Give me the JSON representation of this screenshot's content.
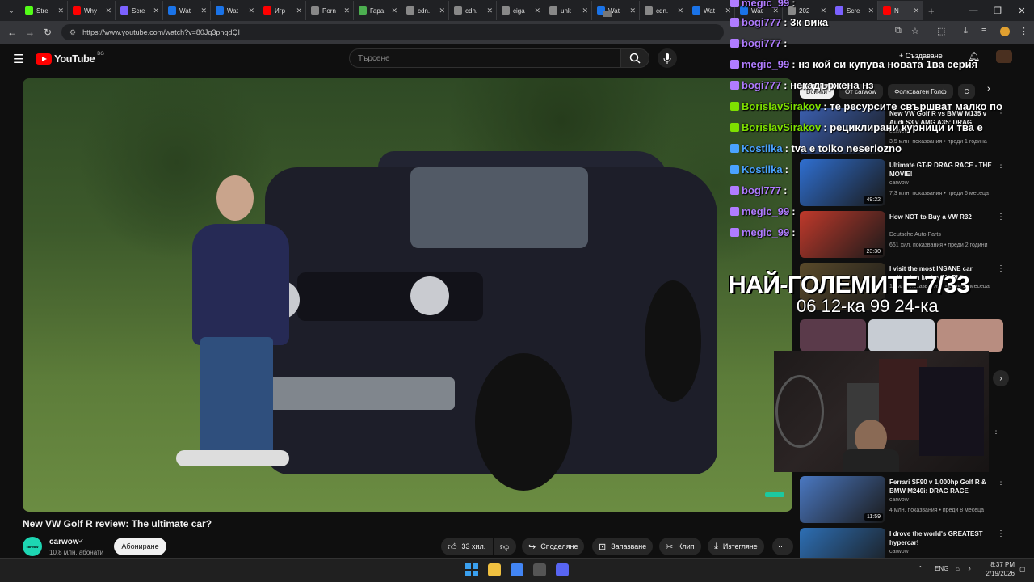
{
  "browser": {
    "tabs": [
      {
        "label": "Stre",
        "color": "#53fc18"
      },
      {
        "label": "Why",
        "color": "#ff0000"
      },
      {
        "label": "Scre",
        "color": "#7b61ff"
      },
      {
        "label": "Wat",
        "color": "#1a73e8"
      },
      {
        "label": "Wat",
        "color": "#1a73e8"
      },
      {
        "label": "Игр",
        "color": "#ff0000"
      },
      {
        "label": "Porn",
        "color": "#888888"
      },
      {
        "label": "Гара",
        "color": "#4caf50"
      },
      {
        "label": "cdn.",
        "color": "#888888"
      },
      {
        "label": "cdn.",
        "color": "#888888"
      },
      {
        "label": "ciga",
        "color": "#888888"
      },
      {
        "label": "unk",
        "color": "#888888"
      },
      {
        "label": "Wat",
        "color": "#1a73e8"
      },
      {
        "label": "cdn.",
        "color": "#888888"
      },
      {
        "label": "Wat",
        "color": "#1a73e8"
      },
      {
        "label": "Wat",
        "color": "#1a73e8"
      },
      {
        "label": "202",
        "color": "#888888"
      },
      {
        "label": "Scre",
        "color": "#7b61ff"
      },
      {
        "label": "N",
        "color": "#ff0000"
      }
    ],
    "url": "https://www.youtube.com/watch?v=80Jq3pnqdQI",
    "new_tab": "+",
    "window": {
      "minimize": "—",
      "restore": "❐",
      "close": "✕"
    }
  },
  "youtube": {
    "logo_text": "YouTube",
    "region": "BG",
    "search_placeholder": "Търсене",
    "create_label": "+ Създаване"
  },
  "video": {
    "title": "New VW Golf R review: The ultimate car?",
    "channel": "carwow",
    "subscribers": "10,8 млн. абонати",
    "subscribe_label": "Абониране",
    "likes": "33 хил.",
    "share_label": "Споделяне",
    "save_label": "Запазване",
    "clip_label": "Клип",
    "download_label": "Изтегляне",
    "more_label": "⋯"
  },
  "chips": [
    "Всички",
    "От carwow",
    "Фолксваген Голф",
    "С"
  ],
  "recommendations": [
    {
      "title": "New VW Golf R vs BMW M135 v Audi S3 v AMG A35: DRAG",
      "channel": "carwow",
      "meta": "3,5 млн. показвания • преди 1 година",
      "duration": "",
      "thumb": "#3b5fb0"
    },
    {
      "title": "Ultimate GT-R DRAG RACE - THE MOVIE!",
      "channel": "carwow",
      "meta": "7,3 млн. показвания • преди 6 месеца",
      "duration": "49:22",
      "thumb": "#2f6fd1"
    },
    {
      "title": "How NOT to Buy a VW R32",
      "channel": "Deutsche Auto Parts",
      "meta": "661 хил. показвания • преди 2 години",
      "duration": "23:30",
      "thumb": "#c0392b"
    },
    {
      "title": "I visit the most INSANE car collection in the WORLD",
      "channel": "",
      "meta": "11 млн. показвания • преди 11 месеца",
      "duration": "",
      "thumb": "#5a4a2a"
    },
    {
      "title": "Ferrari SF90 v 1,000hp Golf R & BMW M240i: DRAG RACE",
      "channel": "carwow",
      "meta": "4 млн. показвания • преди 8 месеца",
      "duration": "11:59",
      "thumb": "#4a78c2"
    },
    {
      "title": "I drove the world's GREATEST hypercar!",
      "channel": "carwow",
      "meta": "",
      "duration": "",
      "thumb": "#2d6fb5"
    }
  ],
  "overlay": {
    "chat": [
      {
        "user": "megic_99",
        "msg": ":",
        "color": "#b07cff"
      },
      {
        "user": "bogi777",
        "msg": ": 3к вика",
        "color": "#b07cff"
      },
      {
        "user": "bogi777",
        "msg": ":",
        "color": "#b07cff"
      },
      {
        "user": "megic_99",
        "msg": ": нз кой си купува новата 1ва серия",
        "color": "#b07cff"
      },
      {
        "user": "bogi777",
        "msg": ": некадържена нз",
        "color": "#b07cff"
      },
      {
        "user": "BorislavSirakov",
        "msg": ": те ресурсите свършват малко по",
        "color": "#7ee000"
      },
      {
        "user": "BorislavSirakov",
        "msg": ": рециклирани курници и тва е",
        "color": "#7ee000"
      },
      {
        "user": "Kostilka",
        "msg": ": tva e tolko neseriozno",
        "color": "#4aa3ff"
      },
      {
        "user": "Kostilka",
        "msg": ":",
        "color": "#4aa3ff"
      },
      {
        "user": "bogi777",
        "msg": ":",
        "color": "#b07cff"
      },
      {
        "user": "megic_99",
        "msg": ":",
        "color": "#b07cff"
      },
      {
        "user": "megic_99",
        "msg": ":",
        "color": "#b07cff"
      }
    ],
    "title": "НАЙ-ГОЛЕМИТЕ 7/33",
    "subtitle": "06 12-ка 99 24-ка"
  },
  "taskbar": {
    "lang": "ENG",
    "time": "8:37 PM",
    "date": "2/19/2026",
    "apps": [
      "#0078d4",
      "#f0c040",
      "#4285f4",
      "#555555",
      "#5865f2"
    ]
  }
}
